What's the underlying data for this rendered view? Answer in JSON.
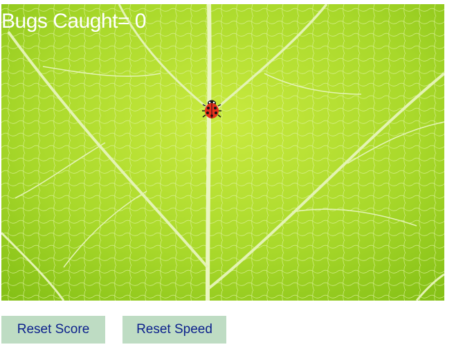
{
  "game": {
    "score_label": "Bugs Caught= 0",
    "bug": "ladybug"
  },
  "controls": {
    "reset_score_label": "Reset Score",
    "reset_speed_label": "Reset Speed"
  },
  "colors": {
    "leaf_light": "#c6e83a",
    "leaf_dark": "#7fbf12",
    "vein": "#e6f5b8",
    "button_bg": "#bedcc3",
    "button_text": "#0b1f8c",
    "ladybug": "#e8321c"
  }
}
